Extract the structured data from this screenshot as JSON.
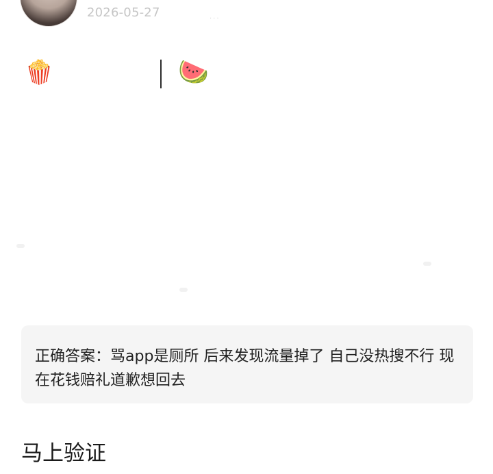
{
  "post": {
    "date": "2026-05-27",
    "header_dots": "···"
  },
  "reactions": {
    "left_emoji": "🍿",
    "right_emoji": "🍉"
  },
  "answer": {
    "text": "正确答案：骂app是厕所 后来发现流量掉了 自己没热搜不行 现在花钱赔礼道歉想回去"
  },
  "verify": {
    "label": "马上验证"
  }
}
